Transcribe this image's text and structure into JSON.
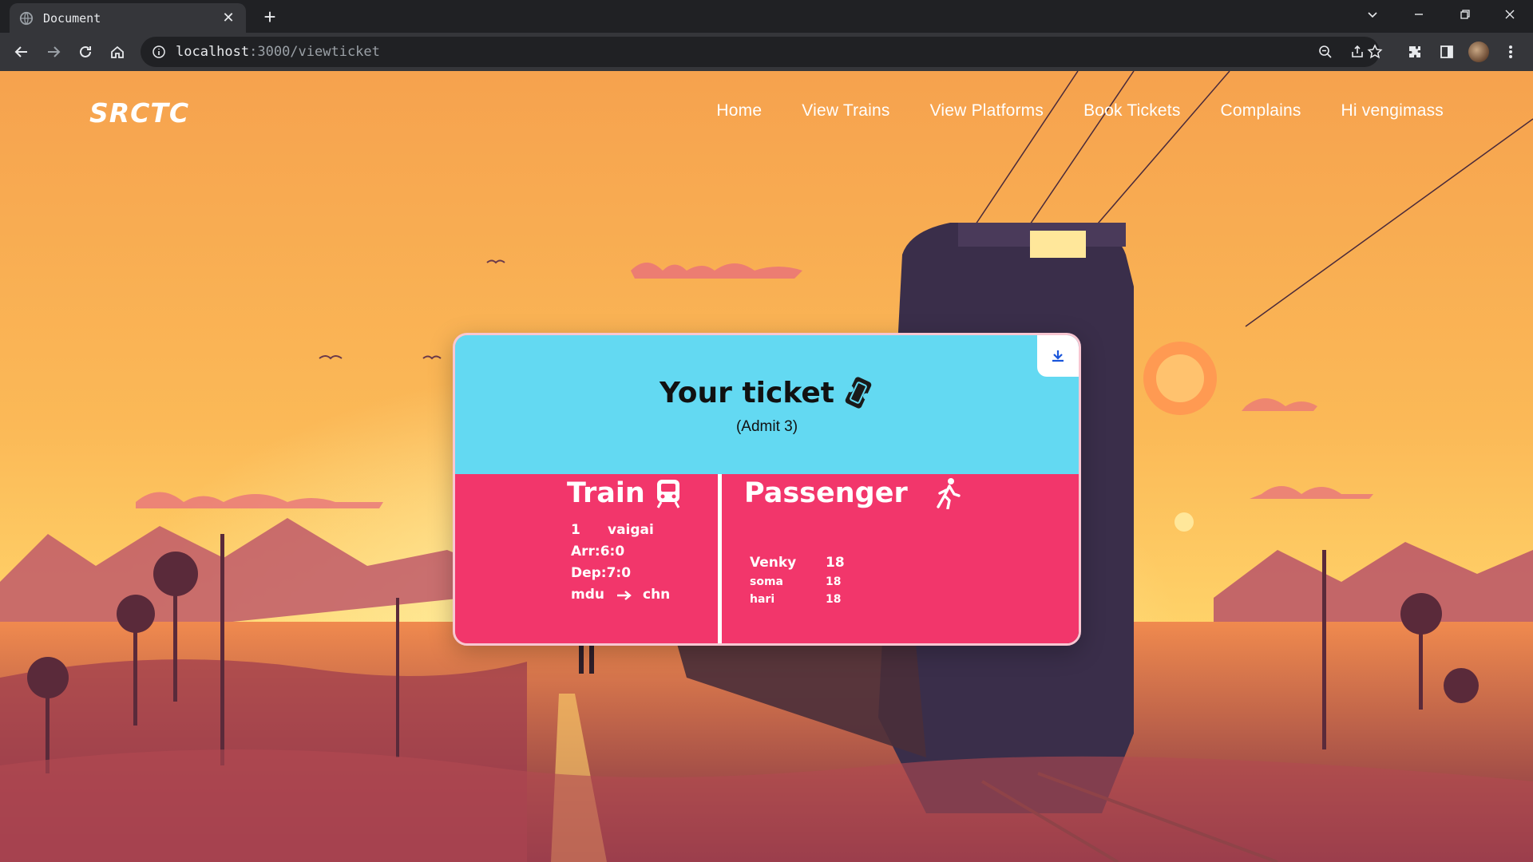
{
  "browser": {
    "tab_title": "Document",
    "url_host": "localhost",
    "url_path": ":3000/viewticket"
  },
  "site": {
    "logo": "SRCTC",
    "nav": [
      "Home",
      "View Trains",
      "View Platforms",
      "Book Tickets",
      "Complains",
      "Hi vengimass"
    ]
  },
  "ticket": {
    "title": "Your ticket",
    "admit": "(Admit 3)",
    "train": {
      "heading": "Train",
      "number": "1",
      "name": "vaigai",
      "arrival": "Arr:6:0",
      "departure": "Dep:7:0",
      "from": "mdu",
      "to": "chn"
    },
    "passenger": {
      "heading": "Passenger",
      "list": [
        {
          "name": "Venky",
          "age": "18"
        },
        {
          "name": "soma",
          "age": "18"
        },
        {
          "name": "hari",
          "age": "18"
        }
      ]
    }
  },
  "colors": {
    "ticket_top": "#63d9f2",
    "ticket_bottom": "#f2366b",
    "sky_top": "#f6a24e",
    "sky_horizon": "#ffd46a"
  }
}
